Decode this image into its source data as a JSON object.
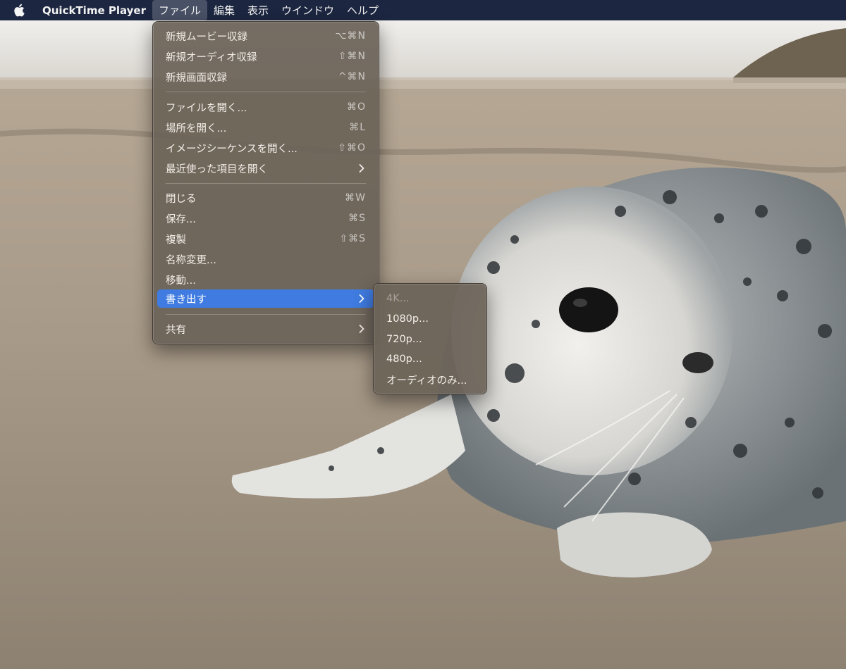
{
  "menubar": {
    "app_name": "QuickTime Player",
    "menus": [
      "ファイル",
      "編集",
      "表示",
      "ウインドウ",
      "ヘルプ"
    ]
  },
  "file_menu": {
    "items": [
      {
        "label": "新規ムービー収録",
        "shortcut": "⌥⌘N"
      },
      {
        "label": "新規オーディオ収録",
        "shortcut": "⇧⌘N"
      },
      {
        "label": "新規画面収録",
        "shortcut": "^⌘N"
      },
      {
        "label": "ファイルを開く...",
        "shortcut": "⌘O"
      },
      {
        "label": "場所を開く...",
        "shortcut": "⌘L"
      },
      {
        "label": "イメージシーケンスを開く...",
        "shortcut": "⇧⌘O"
      },
      {
        "label": "最近使った項目を開く",
        "shortcut": ""
      },
      {
        "label": "閉じる",
        "shortcut": "⌘W"
      },
      {
        "label": "保存...",
        "shortcut": "⌘S"
      },
      {
        "label": "複製",
        "shortcut": "⇧⌘S"
      },
      {
        "label": "名称変更...",
        "shortcut": ""
      },
      {
        "label": "移動...",
        "shortcut": ""
      },
      {
        "label": "書き出す",
        "shortcut": ""
      },
      {
        "label": "共有",
        "shortcut": ""
      }
    ]
  },
  "export_menu": {
    "items": [
      {
        "label": "4K...",
        "enabled": false
      },
      {
        "label": "1080p...",
        "enabled": true
      },
      {
        "label": "720p...",
        "enabled": true
      },
      {
        "label": "480p...",
        "enabled": true
      },
      {
        "label": "オーディオのみ...",
        "enabled": true
      }
    ]
  },
  "colors": {
    "menubar_bg": "#1c2640",
    "highlight": "#3f7be0",
    "menu_bg": "#6c6358"
  },
  "icons": {
    "apple": "apple-logo-icon",
    "submenu": "chevron-right-icon"
  }
}
